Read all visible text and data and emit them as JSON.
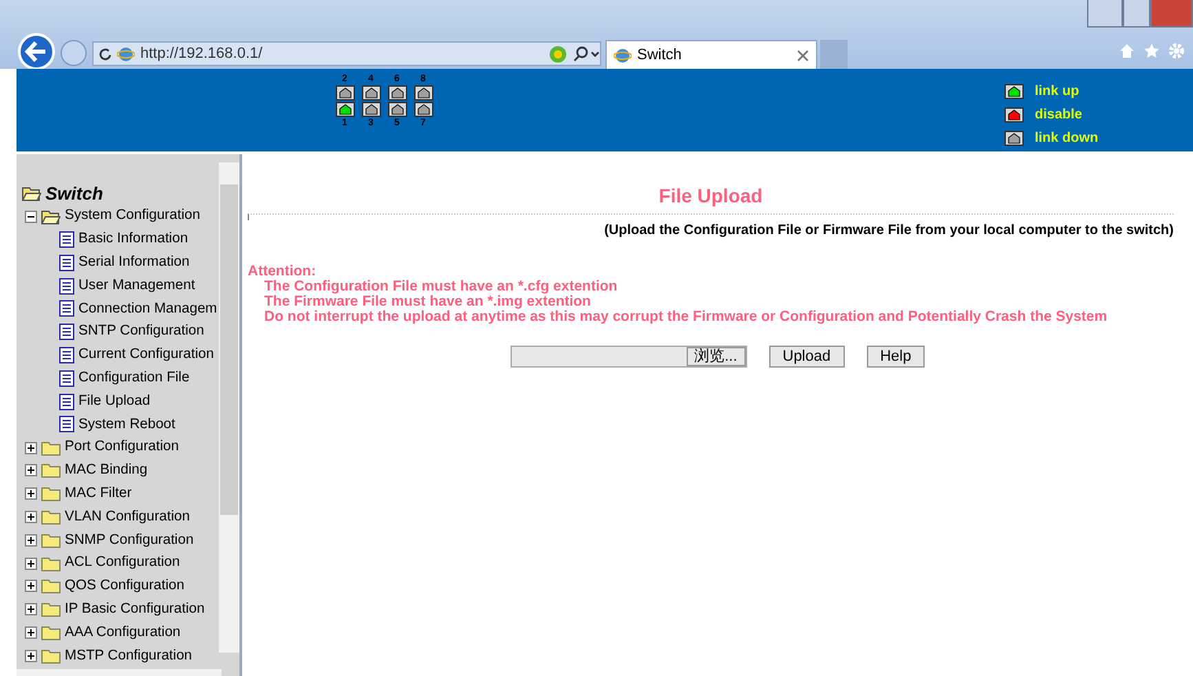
{
  "browser": {
    "address": "http://192.168.0.1/",
    "tab_title": "Switch"
  },
  "ports": {
    "top_row": [
      {
        "label": "2",
        "color": "#a0a0a0"
      },
      {
        "label": "4",
        "color": "#a0a0a0"
      },
      {
        "label": "6",
        "color": "#a0a0a0"
      },
      {
        "label": "8",
        "color": "#a0a0a0"
      }
    ],
    "bottom_row": [
      {
        "label": "1",
        "color": "#00e000"
      },
      {
        "label": "3",
        "color": "#a0a0a0"
      },
      {
        "label": "5",
        "color": "#a0a0a0"
      },
      {
        "label": "7",
        "color": "#a0a0a0"
      }
    ]
  },
  "legend": [
    {
      "label": "link up",
      "color": "#00e000"
    },
    {
      "label": "disable",
      "color": "#ff0000"
    },
    {
      "label": "link down",
      "color": "#a0a0a0"
    }
  ],
  "tree": {
    "label": "Switch",
    "children": [
      {
        "label": "System Configuration",
        "expanded": true,
        "children": [
          {
            "label": "Basic Information"
          },
          {
            "label": "Serial Information"
          },
          {
            "label": "User Management"
          },
          {
            "label": "Connection Managem"
          },
          {
            "label": "SNTP Configuration"
          },
          {
            "label": "Current Configuration"
          },
          {
            "label": "Configuration File"
          },
          {
            "label": "File Upload"
          },
          {
            "label": "System Reboot"
          }
        ]
      },
      {
        "label": "Port Configuration",
        "expanded": false
      },
      {
        "label": "MAC Binding",
        "expanded": false
      },
      {
        "label": "MAC Filter",
        "expanded": false
      },
      {
        "label": "VLAN Configuration",
        "expanded": false
      },
      {
        "label": "SNMP Configuration",
        "expanded": false
      },
      {
        "label": "ACL Configuration",
        "expanded": false
      },
      {
        "label": "QOS Configuration",
        "expanded": false
      },
      {
        "label": "IP Basic Configuration",
        "expanded": false
      },
      {
        "label": "AAA Configuration",
        "expanded": false
      },
      {
        "label": "MSTP Configuration",
        "expanded": false
      }
    ]
  },
  "content": {
    "title": "File Upload",
    "subtitle": "(Upload the Configuration File or Firmware File from your local computer to the switch)",
    "attention": "Attention:",
    "notes": [
      "The Configuration File must have an *.cfg extention",
      "The Firmware File must have an *.img extention",
      "Do not interrupt the upload at anytime as this may corrupt the Firmware or Configuration and Potentially Crash the System"
    ],
    "browse_button": "浏览...",
    "buttons": [
      "Upload",
      "Help"
    ]
  }
}
